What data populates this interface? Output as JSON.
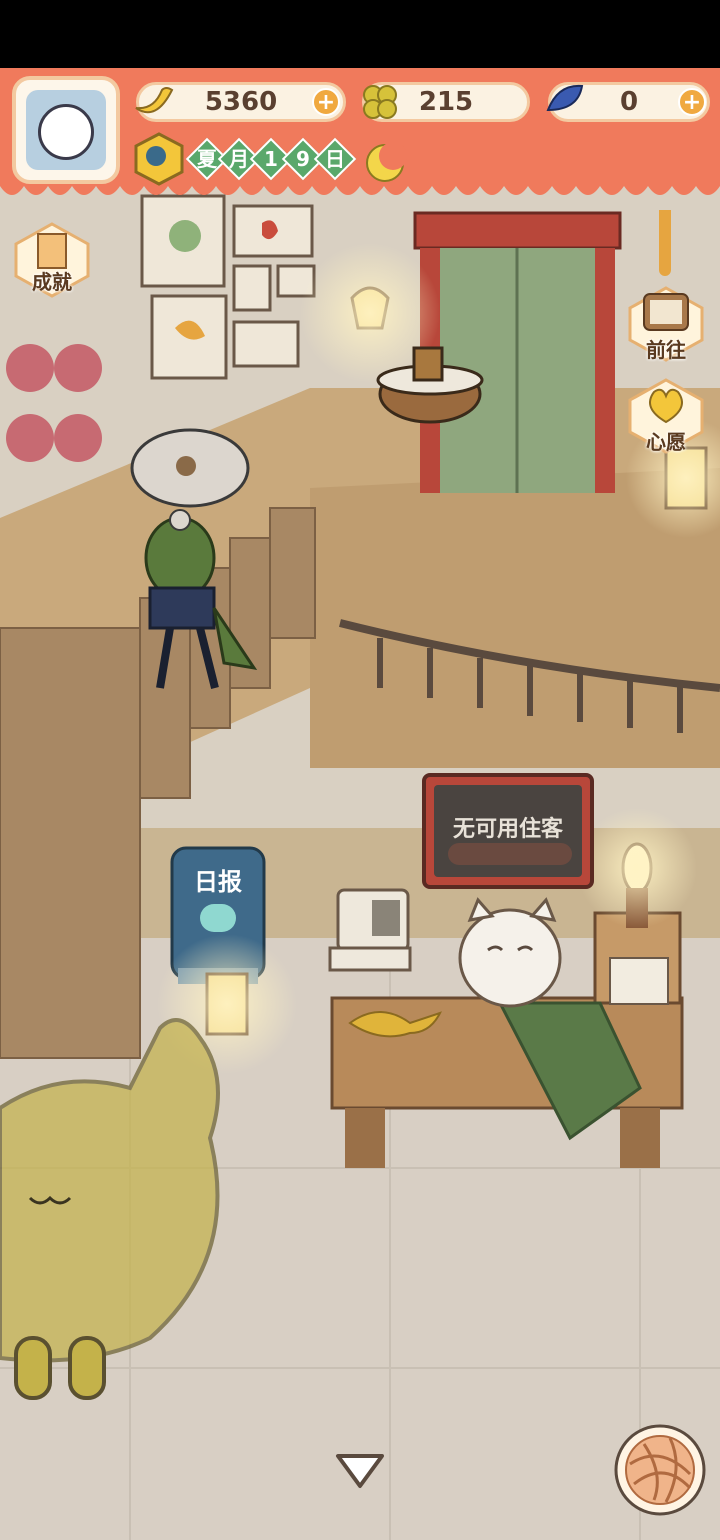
{
  "hud": {
    "bananas": "5360",
    "clovers": "215",
    "fish": "0",
    "plus_symbol": "+",
    "date_chars": [
      "夏",
      "月",
      "1",
      "9",
      "日"
    ]
  },
  "side": {
    "achievements_label": "成就",
    "goto_label": "前往",
    "wish_label": "心愿"
  },
  "scene": {
    "front_desk_sign": "无可用住客",
    "newspaper_label": "日报"
  },
  "colors": {
    "header": "#f07a5c",
    "accent_green": "#5aa86b",
    "floor": "#d8cfc4"
  }
}
